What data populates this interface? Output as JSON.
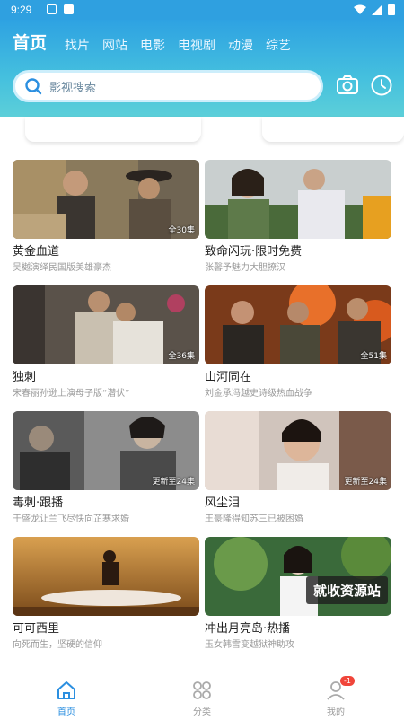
{
  "status_bar": {
    "time": "9:29"
  },
  "header": {
    "tabs": [
      {
        "label": "首页",
        "active": true
      },
      {
        "label": "找片"
      },
      {
        "label": "网站"
      },
      {
        "label": "电影"
      },
      {
        "label": "电视剧"
      },
      {
        "label": "动漫"
      },
      {
        "label": "综艺"
      }
    ],
    "search": {
      "placeholder": "影视搜索"
    }
  },
  "videos": [
    {
      "title": "黄金血道",
      "subtitle": "吴樾演绎民国版美雄豪杰",
      "badge": "全30集"
    },
    {
      "title": "致命闪玩·限时免费",
      "subtitle": "张馨予魅力大胆撩汉",
      "badge": ""
    },
    {
      "title": "独刺",
      "subtitle": "宋春丽孙逊上演母子版“潜伏”",
      "badge": "全36集"
    },
    {
      "title": "山河同在",
      "subtitle": "刘金承冯越史诗级热血战争",
      "badge": "全51集"
    },
    {
      "title": "毒刺·跟播",
      "subtitle": "于盛龙让兰飞尽快向芷寒求婚",
      "badge": "更新至24集"
    },
    {
      "title": "风尘泪",
      "subtitle": "王豪隆得知苏三已被困婚",
      "badge": "更新至24集"
    },
    {
      "title": "可可西里",
      "subtitle": "向死而生，坚硬的信仰",
      "badge": ""
    },
    {
      "title": "冲出月亮岛·热播",
      "subtitle": "玉女韩雪变越狱神助攻",
      "badge": ""
    }
  ],
  "watermark": "就收资源站",
  "bottom_nav": [
    {
      "label": "首页",
      "icon": "home-icon",
      "active": true
    },
    {
      "label": "分类",
      "icon": "category-icon"
    },
    {
      "label": "我的",
      "icon": "profile-icon",
      "badge": "-1"
    }
  ],
  "colors": {
    "accent": "#2b8fe0",
    "header_top": "#2ea2e2",
    "header_bottom": "#5ccfd9"
  }
}
